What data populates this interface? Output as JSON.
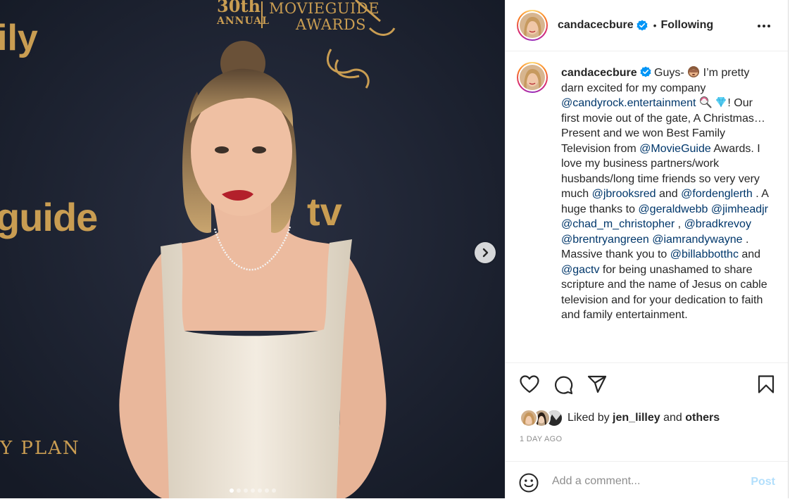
{
  "post": {
    "author": "candacecbure",
    "follow_separator": "•",
    "follow_state": "Following",
    "verified": true
  },
  "media": {
    "backdrop_texts": {
      "anniversary_number": "30th",
      "anniversary_word": "ANNUAL",
      "awards_line1": "MOVIEGUIDE",
      "awards_line2": "AWARDS",
      "left_logo_fragment": "ily",
      "guide_logo_fragment": "guide",
      "tv_logo_fragment": "tv",
      "plan_fragment": "Y PLAN"
    },
    "slide_count": 7,
    "active_slide": 1
  },
  "caption": {
    "segments": [
      {
        "type": "text",
        "value": " Guys- "
      },
      {
        "type": "emoji",
        "name": "see-no-evil-monkey-emoji"
      },
      {
        "type": "text",
        "value": " I’m pretty darn excited for my company "
      },
      {
        "type": "mention",
        "value": "@candyrock.entertainment"
      },
      {
        "type": "text",
        "value": " "
      },
      {
        "type": "emoji",
        "name": "lollipop-emoji"
      },
      {
        "type": "text",
        "value": " "
      },
      {
        "type": "emoji",
        "name": "gem-emoji"
      },
      {
        "type": "text",
        "value": "! Our first movie out of the gate, A Christmas…Present and we won Best Family Television from "
      },
      {
        "type": "mention",
        "value": "@MovieGuide"
      },
      {
        "type": "text",
        "value": " Awards. I love my business partners/work husbands/long time friends so very very much "
      },
      {
        "type": "mention",
        "value": "@jbrooksred"
      },
      {
        "type": "text",
        "value": " and "
      },
      {
        "type": "mention",
        "value": "@fordenglerth"
      },
      {
        "type": "text",
        "value": " . A huge thanks to "
      },
      {
        "type": "mention",
        "value": "@geraldwebb"
      },
      {
        "type": "text",
        "value": " "
      },
      {
        "type": "mention",
        "value": "@jimheadjr"
      },
      {
        "type": "text",
        "value": " "
      },
      {
        "type": "mention",
        "value": "@chad_m_christopher"
      },
      {
        "type": "text",
        "value": " , "
      },
      {
        "type": "mention",
        "value": "@bradkrevoy"
      },
      {
        "type": "text",
        "value": " "
      },
      {
        "type": "mention",
        "value": "@brentryangreen"
      },
      {
        "type": "text",
        "value": " "
      },
      {
        "type": "mention",
        "value": "@iamrandywayne"
      },
      {
        "type": "text",
        "value": " . Massive thank you to "
      },
      {
        "type": "mention",
        "value": "@billabbotthc"
      },
      {
        "type": "text",
        "value": " and "
      },
      {
        "type": "mention",
        "value": "@gactv"
      },
      {
        "type": "text",
        "value": " for being unashamed to share scripture and the name of Jesus on cable television and for your dedication to faith and family entertainment."
      }
    ]
  },
  "likes": {
    "prefix": "Liked by",
    "user": "jen_lilley",
    "joiner": "and",
    "others": "others"
  },
  "timestamp": "1 DAY AGO",
  "comment": {
    "placeholder": "Add a comment...",
    "post_label": "Post"
  },
  "colors": {
    "mention": "#00376b",
    "verified": "#0095f6",
    "post_disabled": "#b2dffc",
    "muted": "#8e8e8e",
    "backdrop": "#1c2030",
    "backdrop_gold": "#c99d52"
  },
  "icons": [
    "heart-icon",
    "comment-icon",
    "share-icon",
    "bookmark-icon",
    "more-options-icon",
    "emoji-icon",
    "chevron-right-icon",
    "verified-badge-icon"
  ]
}
